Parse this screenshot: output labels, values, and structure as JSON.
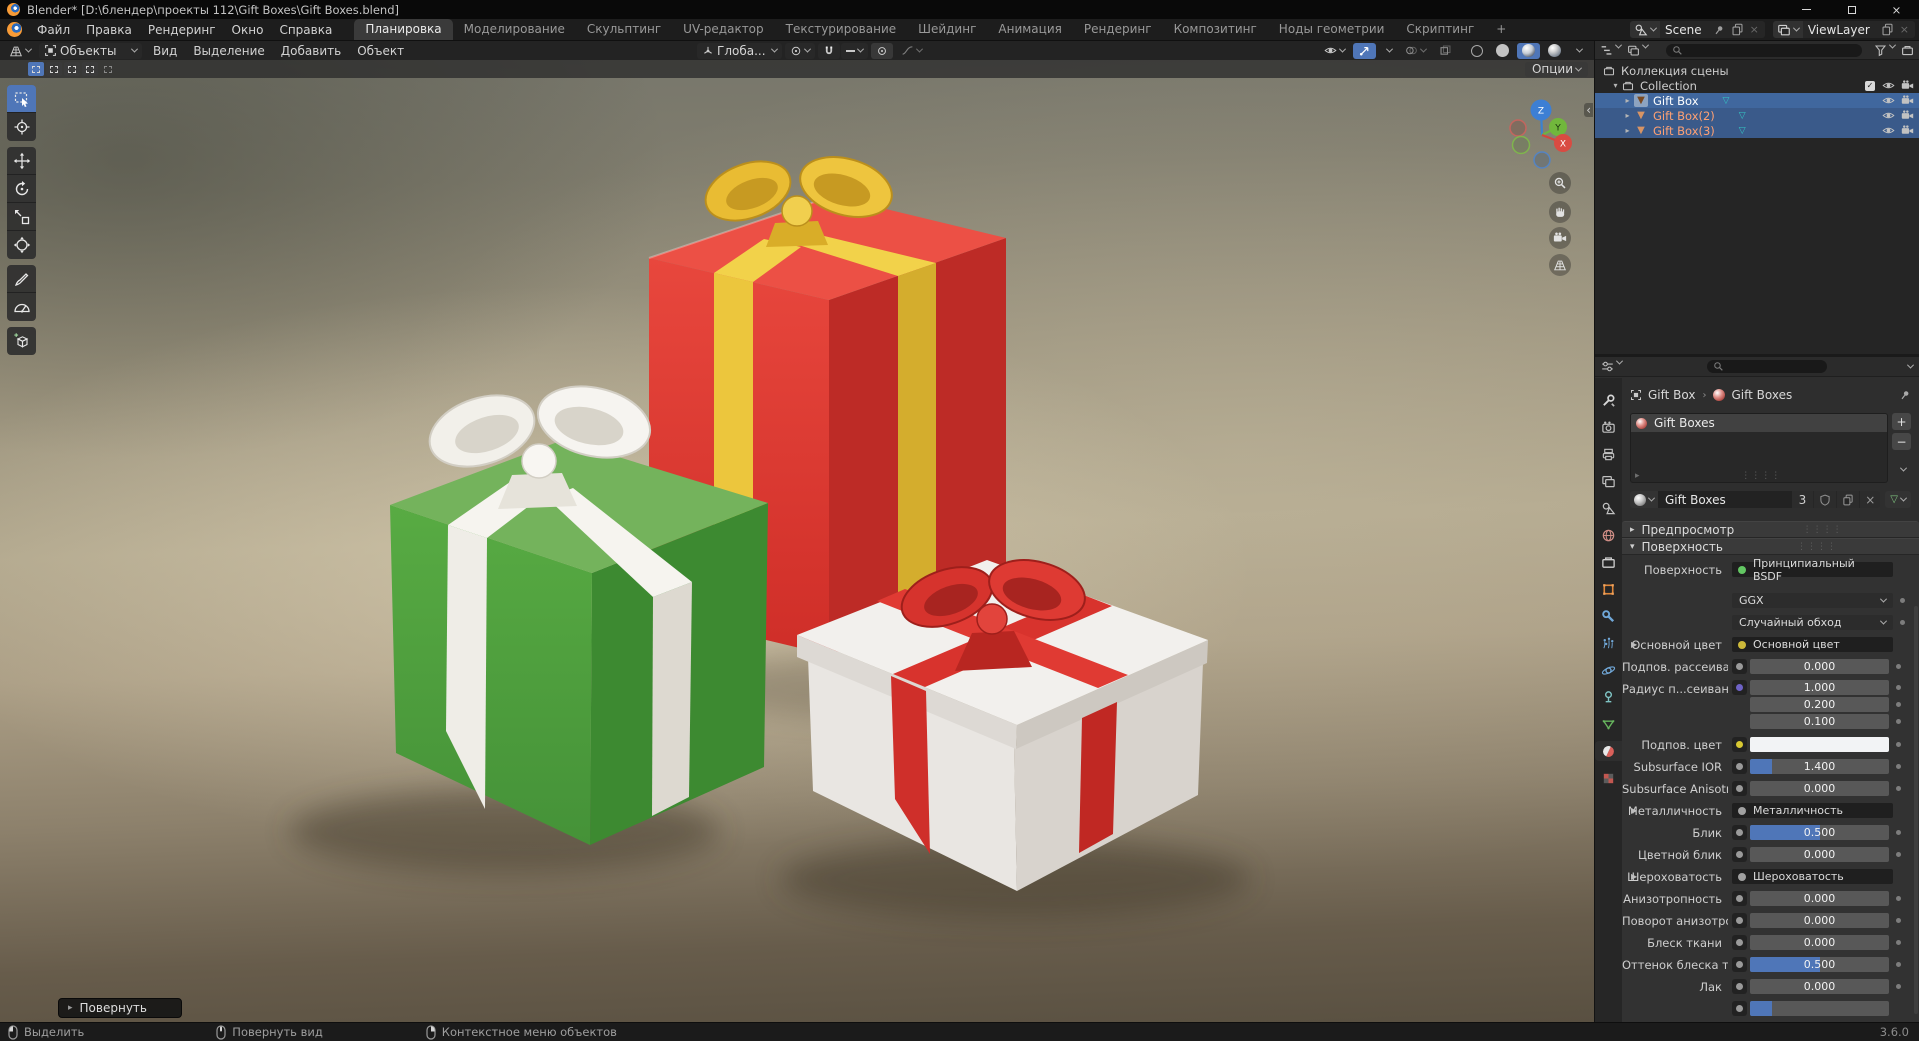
{
  "window": {
    "title": "Blender* [D:\\блендер\\проекты 112\\Gift Boxes\\Gift Boxes.blend]"
  },
  "topbar": {
    "menus": [
      "Файл",
      "Правка",
      "Рендеринг",
      "Окно",
      "Справка"
    ],
    "tabs": [
      "Планировка",
      "Моделирование",
      "Скульптинг",
      "UV-редактор",
      "Текстурирование",
      "Шейдинг",
      "Анимация",
      "Рендеринг",
      "Композитинг",
      "Ноды геометрии",
      "Скриптинг"
    ],
    "new_tab": "+",
    "scene_label": "Scene",
    "viewlayer_label": "ViewLayer"
  },
  "viewport": {
    "mode": "Объекты",
    "menus": [
      "Вид",
      "Выделение",
      "Добавить",
      "Объект"
    ],
    "orientation": "Глоба...",
    "options": "Опции",
    "operator": "Повернуть",
    "gizmo": {
      "x": "X",
      "y": "Y",
      "z": "Z"
    }
  },
  "outliner": {
    "rows": [
      "Коллекция сцены",
      "Collection",
      "Gift Box",
      "Gift Box(2)",
      "Gift Box(3)"
    ]
  },
  "properties": {
    "breadcrumb": {
      "object": "Gift Box",
      "material": "Gift Boxes"
    },
    "slot_name": "Gift Boxes",
    "material_name": "Gift Boxes",
    "users": "3",
    "panel_preview": "Предпросмотр",
    "panel_surface": "Поверхность",
    "fields": [
      {
        "label": "Поверхность",
        "value": "Принципиальный BSDF",
        "socket": "#63c763"
      },
      {
        "label": "",
        "value": "GGX"
      },
      {
        "label": "",
        "value": "Случайный обход"
      },
      {
        "label": "Основной цвет",
        "value": "Основной цвет",
        "socket": "#cdb93a"
      },
      {
        "label": "Подпов. рассеива...",
        "value": "0.000",
        "fill": 0,
        "socket": "#9a9a9a"
      },
      {
        "label": "Радиус п...сеивания",
        "values": [
          "1.000",
          "0.200",
          "0.100"
        ],
        "socket": "#6e62c6"
      },
      {
        "label": "Подпов. цвет",
        "swatch": "#f2f3f5",
        "socket": "#d8c832"
      },
      {
        "label": "Subsurface IOR",
        "value": "1.400",
        "fill": 0.16,
        "socket": "#9a9a9a"
      },
      {
        "label": "Subsurface Anisotr...",
        "value": "0.000",
        "fill": 0,
        "socket": "#9a9a9a"
      },
      {
        "label": "Металличность",
        "value": "Металличность",
        "socket": "#a1a1a1"
      },
      {
        "label": "Блик",
        "value": "0.500",
        "fill": 0.5,
        "socket": "#9a9a9a"
      },
      {
        "label": "Цветной блик",
        "value": "0.000",
        "fill": 0,
        "socket": "#9a9a9a"
      },
      {
        "label": "Шероховатость",
        "value": "Шероховатость",
        "socket": "#a1a1a1"
      },
      {
        "label": "Анизотропность",
        "value": "0.000",
        "fill": 0,
        "socket": "#9a9a9a"
      },
      {
        "label": "Поворот анизотро...",
        "value": "0.000",
        "fill": 0,
        "socket": "#9a9a9a"
      },
      {
        "label": "Блеск ткани",
        "value": "0.000",
        "fill": 0,
        "socket": "#9a9a9a"
      },
      {
        "label": "Оттенок блеска тк...",
        "value": "0.500",
        "fill": 0.5,
        "socket": "#9a9a9a"
      },
      {
        "label": "Лак",
        "value": "0.000",
        "fill": 0,
        "socket": "#9a9a9a"
      }
    ]
  },
  "statusbar": {
    "items": [
      "Выделить",
      "Повернуть вид",
      "Контекстное меню объектов"
    ],
    "version": "3.6.0"
  },
  "colors": {
    "accent": "#4f76b8",
    "selection_row": "#3a5a8a",
    "selected_object_text": "#ffa173",
    "slider_fill": "#4f76b8"
  }
}
